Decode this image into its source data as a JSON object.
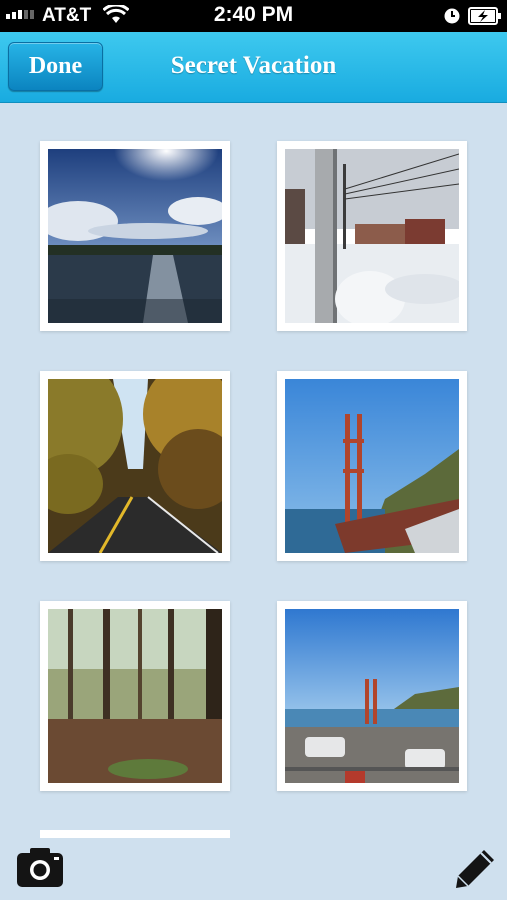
{
  "status": {
    "carrier": "AT&T",
    "time": "2:40 PM"
  },
  "nav": {
    "done_label": "Done",
    "title": "Secret Vacation"
  },
  "photos": [
    {
      "subject": "lake"
    },
    {
      "subject": "snowy-street"
    },
    {
      "subject": "autumn-road"
    },
    {
      "subject": "golden-gate-bridge"
    },
    {
      "subject": "forest"
    },
    {
      "subject": "golden-gate-parking"
    }
  ],
  "toolbar": {
    "camera_icon": "camera-icon",
    "edit_icon": "pencil-icon"
  },
  "colors": {
    "nav_bar": "#19abe0",
    "background": "#cfe0ee"
  }
}
